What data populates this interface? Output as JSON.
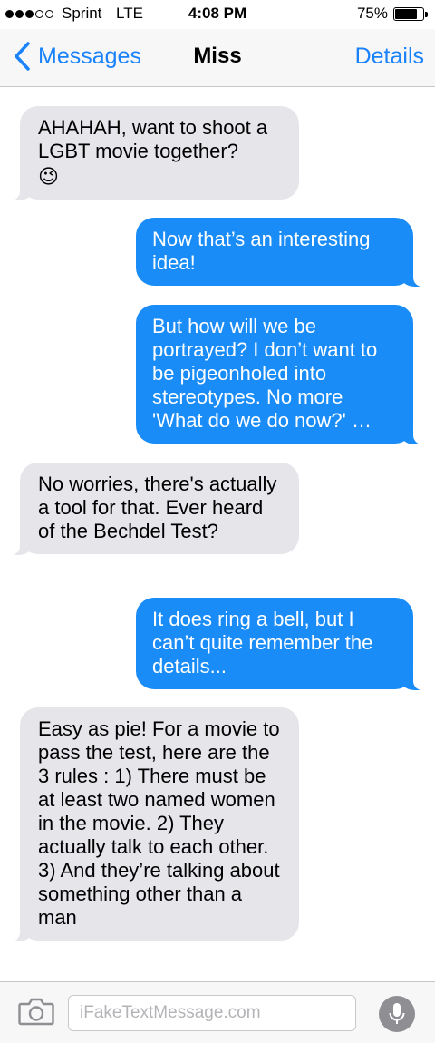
{
  "status_bar": {
    "carrier": "Sprint",
    "network": "LTE",
    "time": "4:08 PM",
    "battery": "75%",
    "battery_level": 0.75,
    "signal_bars_filled": 3,
    "signal_bars_total": 5
  },
  "nav": {
    "back_label": "Messages",
    "title": "Miss",
    "details_label": "Details"
  },
  "messages": [
    {
      "direction": "incoming",
      "text": "AHAHAH, want to shoot a LGBT movie together?",
      "emoji": "😉"
    },
    {
      "direction": "outgoing",
      "text": "Now that’s an interesting idea!"
    },
    {
      "direction": "outgoing",
      "text": "But how will we be portrayed? I don’t want to be pigeonholed into stereotypes. No more 'What do we do now?' …"
    },
    {
      "direction": "incoming",
      "text": "No worries, there's actually a tool for that. Ever heard of the Bechdel Test?"
    },
    {
      "direction": "outgoing",
      "text": "It does ring a bell, but I can’t quite remember the details..."
    },
    {
      "direction": "incoming",
      "text": "Easy as pie! For a movie to pass the test, here are the 3 rules : 1) There must be at least two named women in the movie. 2) They actually talk to each other. 3) And they’re talking about something other than a man"
    }
  ],
  "input_bar": {
    "placeholder": "iFakeTextMessage.com",
    "camera_icon": "camera-icon",
    "mic_icon": "microphone-icon"
  },
  "colors": {
    "accent": "#1a82fb",
    "outgoing_bubble": "#1a8cf7",
    "incoming_bubble": "#e5e5ea"
  }
}
